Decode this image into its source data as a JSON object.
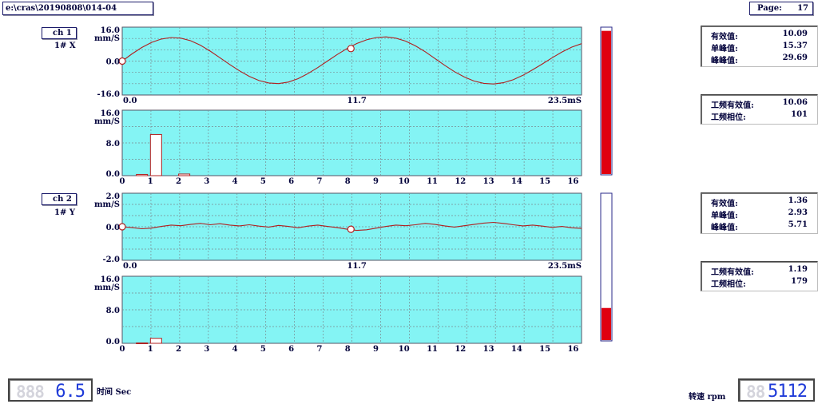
{
  "header": {
    "file_path": "e:\\cras\\20190808\\014-04",
    "page_label": "Page:",
    "page_number": "17"
  },
  "units": {
    "velocity": "mm/S"
  },
  "channels": [
    {
      "name": "ch 1",
      "sensor": "1# X",
      "bar_level": 0.98,
      "waveform": {
        "type": "line",
        "y_ticks": [
          "16.0",
          "0.0",
          "-16.0"
        ],
        "ylim": [
          -16,
          16
        ],
        "x_ticks": [
          "0.0",
          "11.7",
          "23.5mS"
        ],
        "xlim": [
          0,
          23.5
        ],
        "x": [
          0,
          0.5,
          1,
          1.5,
          2,
          2.5,
          3,
          3.5,
          4,
          4.5,
          5,
          5.5,
          6,
          6.5,
          7,
          7.5,
          8,
          8.5,
          9,
          9.5,
          10,
          10.5,
          11,
          11.5,
          12,
          12.5,
          13,
          13.5,
          14,
          14.5,
          15,
          15.5,
          16,
          16.5,
          17,
          17.5,
          18,
          18.5,
          19,
          19.5,
          20,
          20.5,
          21,
          21.5,
          22,
          22.5,
          23,
          23.5
        ],
        "y": [
          0,
          3.4,
          6.4,
          8.8,
          10.4,
          11.1,
          10.8,
          9.6,
          7.5,
          4.7,
          1.6,
          -1.6,
          -4.6,
          -7.2,
          -9.2,
          -10.3,
          -10.6,
          -9.9,
          -8.3,
          -5.9,
          -3.1,
          0,
          3.1,
          5.9,
          8.3,
          10,
          11.1,
          11.4,
          10.8,
          9.4,
          7.2,
          4.4,
          1.2,
          -2,
          -5,
          -7.5,
          -9.4,
          -10.5,
          -10.8,
          -10.2,
          -8.8,
          -6.7,
          -4.1,
          -1.3,
          1.6,
          4.3,
          6.6,
          8.2
        ],
        "markers_x": [
          0,
          11.7
        ]
      },
      "spectrum": {
        "type": "bar",
        "y_ticks": [
          "16.0",
          "8.0",
          "0.0"
        ],
        "ylim": [
          0,
          16
        ],
        "x_ticks": [
          "0",
          "1",
          "2",
          "3",
          "4",
          "5",
          "6",
          "7",
          "8",
          "9",
          "10",
          "11",
          "12",
          "13",
          "14",
          "15",
          "16"
        ],
        "xlim": [
          0,
          16.3
        ],
        "bars": [
          {
            "x": 0.7,
            "value": 0.3
          },
          {
            "x": 1.2,
            "value": 10.06
          },
          {
            "x": 2.2,
            "value": 0.4
          }
        ]
      },
      "stats": [
        {
          "label": "有效值:",
          "value": "10.09"
        },
        {
          "label": "单峰值:",
          "value": "15.37"
        },
        {
          "label": "峰峰值:",
          "value": "29.69"
        }
      ],
      "freq_stats": [
        {
          "label": "工频有效值:",
          "value": "10.06"
        },
        {
          "label": "工频相位:",
          "value": "101"
        }
      ]
    },
    {
      "name": "ch 2",
      "sensor": "1# Y",
      "bar_level": 0.22,
      "waveform": {
        "type": "line",
        "y_ticks": [
          "2.0",
          "0.0",
          "-2.0"
        ],
        "ylim": [
          -2,
          2
        ],
        "x_ticks": [
          "0.0",
          "11.7",
          "23.5mS"
        ],
        "xlim": [
          0,
          23.5
        ],
        "x": [
          0,
          0.5,
          1,
          1.5,
          2,
          2.5,
          3,
          3.5,
          4,
          4.5,
          5,
          5.5,
          6,
          6.5,
          7,
          7.5,
          8,
          8.5,
          9,
          9.5,
          10,
          10.5,
          11,
          11.5,
          12,
          12.5,
          13,
          13.5,
          14,
          14.5,
          15,
          15.5,
          16,
          16.5,
          17,
          17.5,
          18,
          18.5,
          19,
          19.5,
          20,
          20.5,
          21,
          21.5,
          22,
          22.5,
          23,
          23.5
        ],
        "y": [
          0,
          -0.05,
          -0.12,
          -0.08,
          0.02,
          0.1,
          0.06,
          0.14,
          0.2,
          0.12,
          0.18,
          0.1,
          0.05,
          0.12,
          0.04,
          -0.02,
          0.08,
          0.02,
          -0.06,
          0.04,
          0.1,
          0.02,
          -0.05,
          -0.15,
          -0.22,
          -0.18,
          -0.08,
          0.02,
          0.1,
          0.06,
          0.12,
          0.2,
          0.14,
          0.05,
          -0.02,
          0.06,
          0.14,
          0.22,
          0.26,
          0.2,
          0.12,
          0.05,
          0.1,
          0.04,
          -0.04,
          0.02,
          -0.06,
          -0.1
        ],
        "markers_x": [
          0,
          11.7
        ]
      },
      "spectrum": {
        "type": "bar",
        "y_ticks": [
          "16.0",
          "8.0",
          "0.0"
        ],
        "ylim": [
          0,
          16
        ],
        "x_ticks": [
          "0",
          "1",
          "2",
          "3",
          "4",
          "5",
          "6",
          "7",
          "8",
          "9",
          "10",
          "11",
          "12",
          "13",
          "14",
          "15",
          "16"
        ],
        "xlim": [
          0,
          16.3
        ],
        "bars": [
          {
            "x": 0.7,
            "value": 0.1
          },
          {
            "x": 1.2,
            "value": 1.19
          }
        ]
      },
      "stats": [
        {
          "label": "有效值:",
          "value": "1.36"
        },
        {
          "label": "单峰值:",
          "value": "2.93"
        },
        {
          "label": "峰峰值:",
          "value": "5.71"
        }
      ],
      "freq_stats": [
        {
          "label": "工频有效值:",
          "value": "1.19"
        },
        {
          "label": "工频相位:",
          "value": "179"
        }
      ]
    }
  ],
  "footer": {
    "time_value": "6.5",
    "time_label": "时间 Sec",
    "speed_label": "转速 rpm",
    "speed_value": "5112"
  },
  "colors": {
    "plot_bg": "#84f4f4",
    "grid": "#7a8a90",
    "trace": "#b02020",
    "bar_fill": "#e00010",
    "lcd_digits": "#1e3ad8"
  }
}
